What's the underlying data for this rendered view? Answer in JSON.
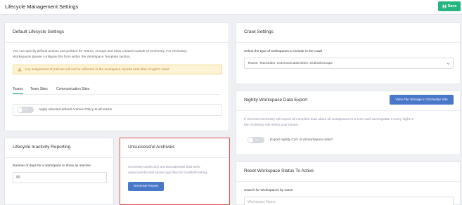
{
  "header": {
    "title": "Lifecycle Management Settings",
    "save_label": "Save"
  },
  "default_lifecycle": {
    "title": "Default Lifecycle Settings",
    "description_line1": "You can specify default actions and policies for Teams, Groups and Sites created outside of Orchestry. For Orchestry",
    "description_line2": "Workspaces please configure this from within the Workspace Template section.",
    "warning": "Any assignment of policies will not be reflected in the workspace reports until after tonight's crawl.",
    "tabs": [
      {
        "label": "Teams"
      },
      {
        "label": "Team Sites"
      },
      {
        "label": "Communication Sites"
      }
    ],
    "toggle_state": "No",
    "toggle_text": "Apply selected default Archive Policy to all teams"
  },
  "inactivity": {
    "title": "Lifecycle Inactivity Reporting",
    "field_label": "Number of days for a workspace to show as inactive",
    "field_value": "90"
  },
  "archivals": {
    "title": "Unsuccessful Archivals",
    "description_line1": "Orchestry tracks any archival attempts that were",
    "description_line2": "unsuccessful and saves logs files for troubleshooting.",
    "button_label": "Generate Report"
  },
  "crawl": {
    "title": "Crawl Settings",
    "select_label": "Select the type of workspaces to include in the crawl",
    "select_value": "Teams, TeamSites, CommunicationSites, OutlookGroups"
  },
  "export": {
    "title": "Nightly Workspace Data Export",
    "button_label": "View File Storage in Orchestry Site",
    "description_line1": "If checked Orchestry will export all compiled data about all workspaces to a CSV and save/update it every night to",
    "description_line2": "the Orchestry site within your tenant.",
    "toggle_state": "No",
    "toggle_text": "Export nightly CSV of all workspace data?"
  },
  "reset": {
    "title": "Reset Workspace Status To Active",
    "search_label": "Search for Workspaces by name",
    "search_placeholder": "Workspace Name"
  },
  "colors": {
    "accent_green": "#24b47e",
    "button_blue": "#4a78c9",
    "highlight_red": "#d9534f",
    "warning_bg": "#fdf3d6"
  }
}
